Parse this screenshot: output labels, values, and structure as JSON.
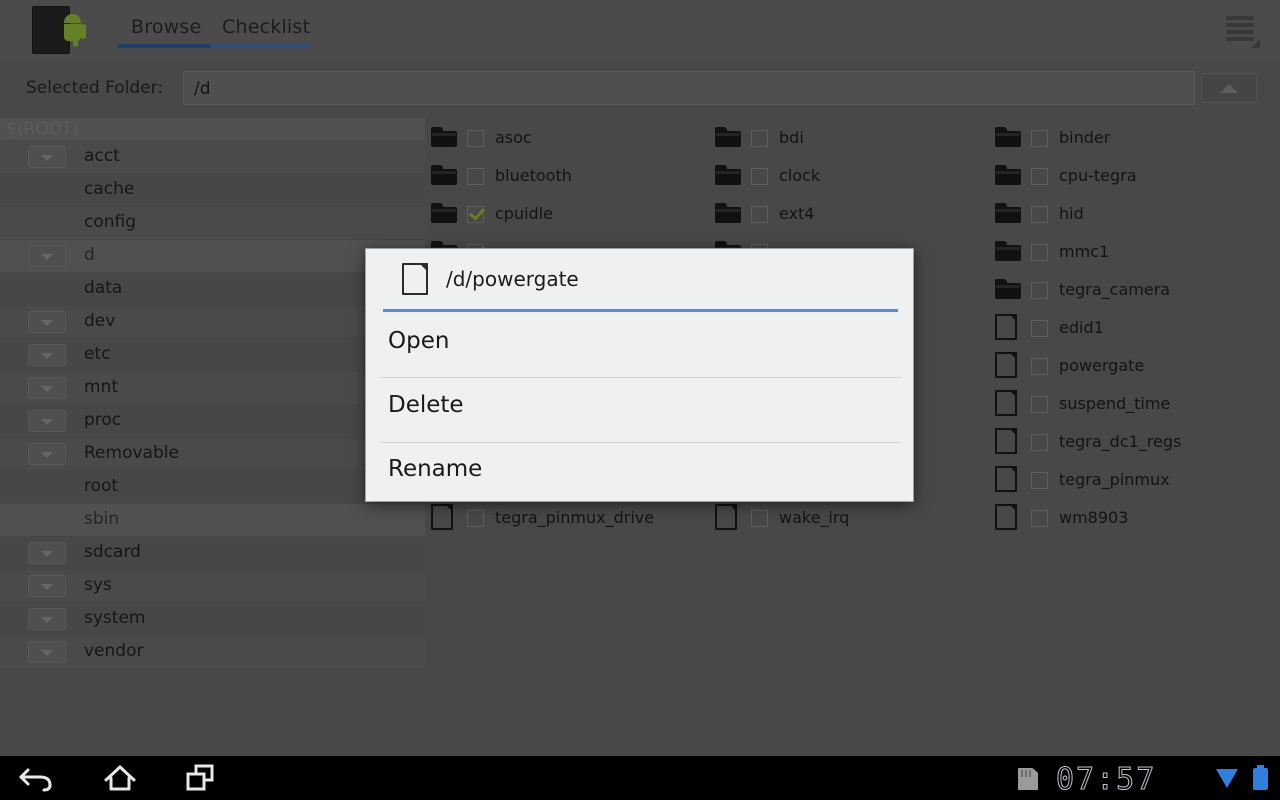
{
  "header": {
    "app_icon": "android-device-icon",
    "tabs": [
      {
        "label": "Browse",
        "active": true
      },
      {
        "label": "Checklist",
        "active": false
      }
    ],
    "overflow_icon": "overflow-menu-icon",
    "accent_color": "#2f5ea6",
    "tab_bar_color": "#4a77b8"
  },
  "pathbar": {
    "label": "Selected Folder:",
    "value": "/d",
    "placeholder": "/d",
    "up_button_icon": "chevron-up-icon"
  },
  "sidebar": {
    "root_label": "$(ROOT)",
    "items": [
      {
        "label": "acct",
        "expandable": true,
        "selected": false
      },
      {
        "label": "cache",
        "expandable": false,
        "selected": false
      },
      {
        "label": "config",
        "expandable": false,
        "selected": false
      },
      {
        "label": "d",
        "expandable": true,
        "selected": true
      },
      {
        "label": "data",
        "expandable": false,
        "selected": false
      },
      {
        "label": "dev",
        "expandable": true,
        "selected": false
      },
      {
        "label": "etc",
        "expandable": true,
        "selected": false
      },
      {
        "label": "mnt",
        "expandable": true,
        "selected": false
      },
      {
        "label": "proc",
        "expandable": true,
        "selected": false
      },
      {
        "label": "Removable",
        "expandable": true,
        "selected": false
      },
      {
        "label": "root",
        "expandable": false,
        "selected": false
      },
      {
        "label": "sbin",
        "expandable": false,
        "selected": true
      },
      {
        "label": "sdcard",
        "expandable": true,
        "selected": false
      },
      {
        "label": "sys",
        "expandable": true,
        "selected": false
      },
      {
        "label": "system",
        "expandable": true,
        "selected": false
      },
      {
        "label": "vendor",
        "expandable": true,
        "selected": false
      }
    ]
  },
  "filegrid": {
    "columns": [
      {
        "items": [
          {
            "name": "asoc",
            "type": "folder",
            "checked": false
          },
          {
            "name": "bluetooth",
            "type": "folder",
            "checked": false
          },
          {
            "name": "cpuidle",
            "type": "folder",
            "checked": true
          },
          {
            "name": "",
            "type": "folder",
            "checked": true
          },
          {
            "name": "",
            "type": "file",
            "checked": false
          },
          {
            "name": "",
            "type": "file",
            "checked": false
          },
          {
            "name": "",
            "type": "file",
            "checked": false
          },
          {
            "name": "",
            "type": "file",
            "checked": false
          },
          {
            "name": "",
            "type": "file",
            "checked": false
          },
          {
            "name": "",
            "type": "file",
            "checked": false
          },
          {
            "name": "tegra_pinmux_drive",
            "type": "file",
            "checked": false
          }
        ]
      },
      {
        "items": [
          {
            "name": "bdi",
            "type": "folder",
            "checked": false
          },
          {
            "name": "clock",
            "type": "folder",
            "checked": false
          },
          {
            "name": "ext4",
            "type": "folder",
            "checked": false
          },
          {
            "name": "",
            "type": "folder",
            "checked": false
          },
          {
            "name": "",
            "type": "file",
            "checked": false
          },
          {
            "name": "",
            "type": "file",
            "checked": false
          },
          {
            "name": "",
            "type": "file",
            "checked": false
          },
          {
            "name": "",
            "type": "file",
            "checked": false
          },
          {
            "name": "",
            "type": "file",
            "checked": false
          },
          {
            "name": "",
            "type": "file",
            "checked": false
          },
          {
            "name": "wake_irq",
            "type": "file",
            "checked": false
          }
        ]
      },
      {
        "items": [
          {
            "name": "binder",
            "type": "folder",
            "checked": false
          },
          {
            "name": "cpu-tegra",
            "type": "folder",
            "checked": false
          },
          {
            "name": "hid",
            "type": "folder",
            "checked": false
          },
          {
            "name": "mmc1",
            "type": "folder",
            "checked": false
          },
          {
            "name": "tegra_camera",
            "type": "folder",
            "checked": false
          },
          {
            "name": "edid1",
            "type": "file",
            "checked": false
          },
          {
            "name": "powergate",
            "type": "file",
            "checked": false
          },
          {
            "name": "suspend_time",
            "type": "file",
            "checked": false
          },
          {
            "name": "tegra_dc1_regs",
            "type": "file",
            "checked": false
          },
          {
            "name": "tegra_pinmux",
            "type": "file",
            "checked": false
          },
          {
            "name": "wm8903",
            "type": "file",
            "checked": false
          }
        ]
      }
    ]
  },
  "dialog": {
    "title": "/d/powergate",
    "title_icon": "file-icon",
    "accent_color": "#5a87d8",
    "items": [
      {
        "label": "Open"
      },
      {
        "label": "Delete"
      },
      {
        "label": "Rename"
      }
    ]
  },
  "navbar": {
    "back_icon": "back-arrow-icon",
    "home_icon": "home-icon",
    "recents_icon": "recent-apps-icon",
    "sd_icon": "sd-card-icon",
    "clock": "07:57",
    "wifi_icon": "wifi-icon",
    "battery_icon": "battery-icon",
    "status_color": "#2f7fe0"
  }
}
